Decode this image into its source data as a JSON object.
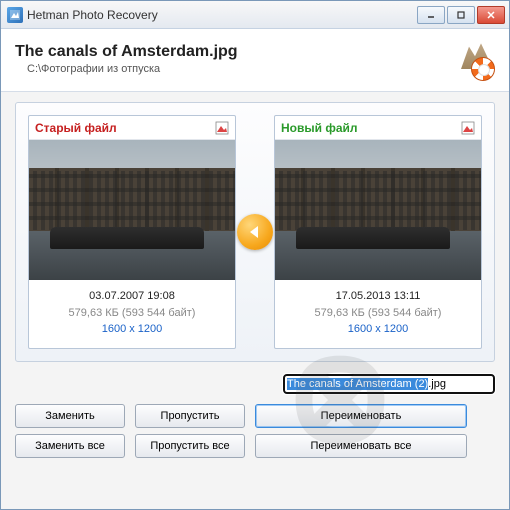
{
  "titlebar": {
    "title": "Hetman Photo Recovery"
  },
  "header": {
    "filename": "The canals of Amsterdam.jpg",
    "path": "C:\\Фотографии из отпуска"
  },
  "panels": {
    "old": {
      "label": "Старый файл",
      "date": "03.07.2007 19:08",
      "size": "579,63 КБ (593 544 байт)",
      "dimensions": "1600 x 1200"
    },
    "new": {
      "label": "Новый файл",
      "date": "17.05.2013 13:11",
      "size": "579,63 КБ (593 544 байт)",
      "dimensions": "1600 x 1200"
    }
  },
  "rename": {
    "value": "The canals of Amsterdam (2).jpg"
  },
  "buttons": {
    "replace": "Заменить",
    "skip": "Пропустить",
    "rename": "Переименовать",
    "replace_all": "Заменить все",
    "skip_all": "Пропустить все",
    "rename_all": "Переименовать все"
  }
}
